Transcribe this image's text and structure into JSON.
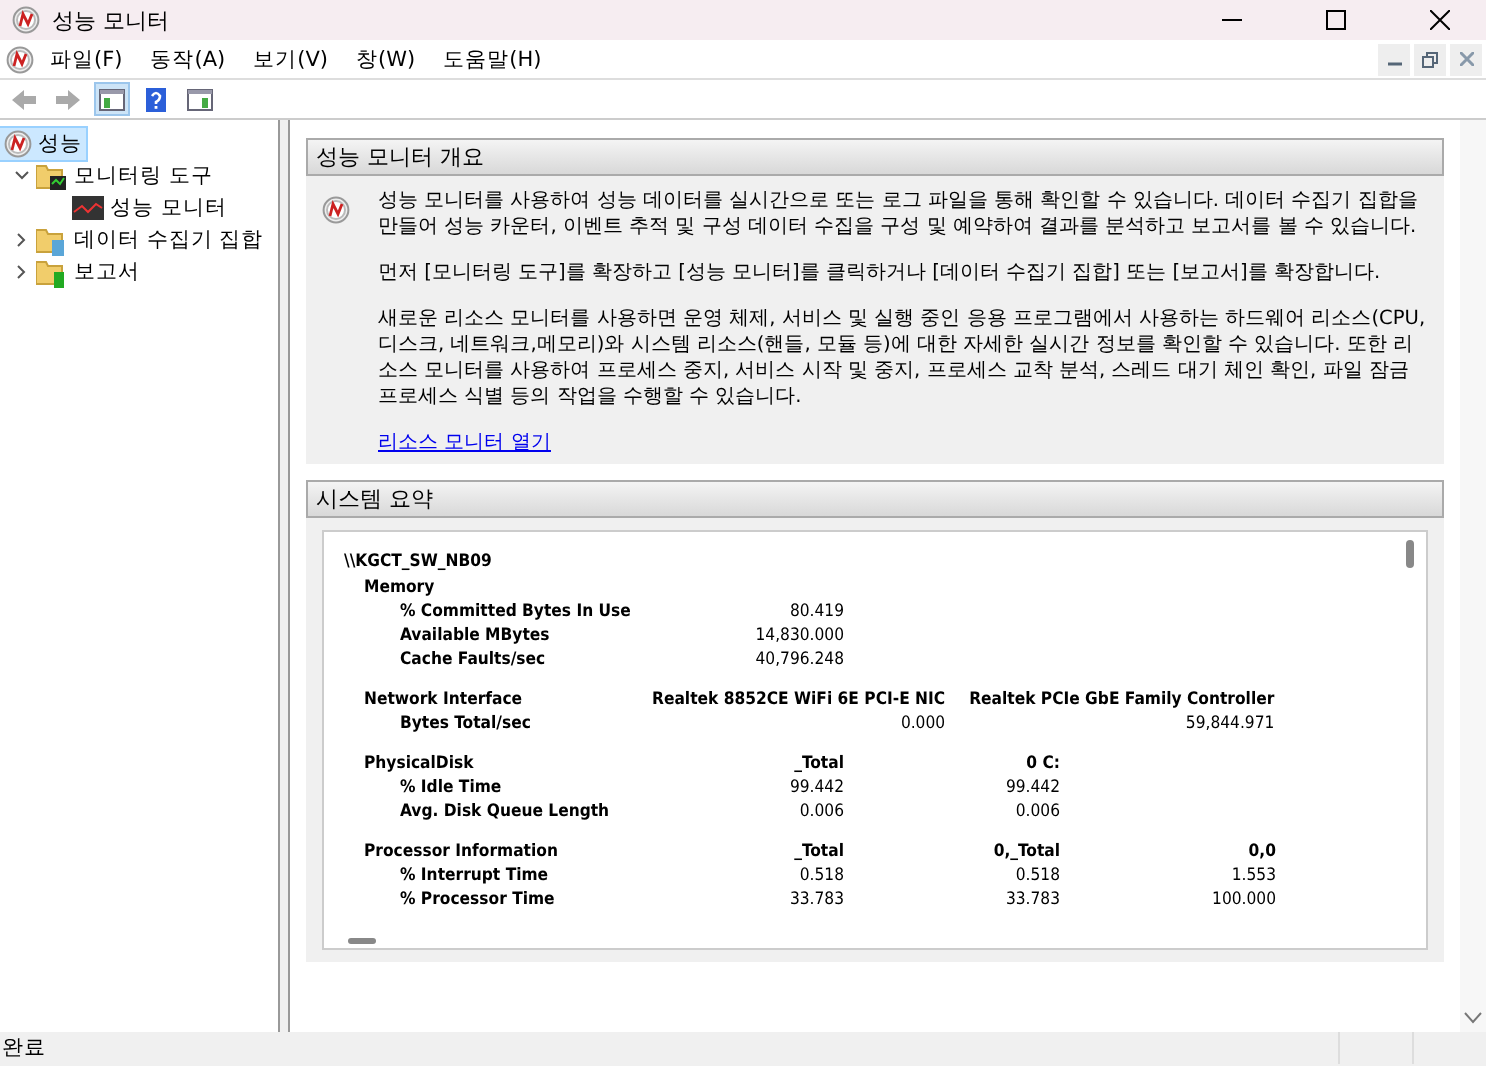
{
  "window": {
    "title": "성능 모니터"
  },
  "menu": [
    "파일(F)",
    "동작(A)",
    "보기(V)",
    "창(W)",
    "도움말(H)"
  ],
  "toolbar": [
    {
      "kind": "back",
      "disabled": true
    },
    {
      "kind": "forward",
      "disabled": true
    },
    {
      "kind": "tree",
      "selected": true
    },
    {
      "kind": "help",
      "selected": false
    },
    {
      "kind": "panel",
      "selected": false
    }
  ],
  "tree": [
    {
      "label": "성능",
      "kind": "perf",
      "selected": true,
      "children": [
        {
          "label": "모니터링 도구",
          "kind": "folder-monitor",
          "expanded": true,
          "selected": false,
          "children": [
            {
              "label": "성능 모니터",
              "kind": "chart",
              "selected": false
            }
          ]
        },
        {
          "label": "데이터 수집기 집합",
          "kind": "folder-collector",
          "expanded": false,
          "selected": false
        },
        {
          "label": "보고서",
          "kind": "folder-report",
          "expanded": false,
          "selected": false
        }
      ]
    }
  ],
  "overview": {
    "title": "성능 모니터 개요",
    "paragraphs": [
      "성능 모니터를 사용하여 성능 데이터를 실시간으로 또는 로그 파일을 통해 확인할 수 있습니다. 데이터 수집기 집합을 만들어 성능 카운터, 이벤트 추적 및 구성 데이터 수집을 구성 및 예약하여 결과를 분석하고 보고서를 볼 수 있습니다.",
      "먼저 [모니터링 도구]를 확장하고 [성능 모니터]를 클릭하거나 [데이터 수집기 집합] 또는 [보고서]를 확장합니다.",
      "새로운 리소스 모니터를 사용하면 운영 체제, 서비스 및 실행 중인 응용 프로그램에서 사용하는 하드웨어 리소스(CPU, 디스크, 네트워크,메모리)와 시스템 리소스(핸들, 모듈 등)에 대한 자세한 실시간 정보를 확인할 수 있습니다. 또한 리소스 모니터를 사용하여 프로세스 중지, 서비스 시작 및 중지, 프로세스 교착 분석, 스레드 대기 체인 확인, 파일 잠금 프로세스 식별 등의 작업을 수행할 수 있습니다."
    ],
    "link": "리소스 모니터 열기"
  },
  "summary": {
    "title": "시스템 요약",
    "host": "\\\\KGCT_SW_NB09",
    "sections": [
      {
        "name": "Memory",
        "counters": [
          {
            "name": "% Committed Bytes In Use",
            "values": [
              "80.419"
            ]
          },
          {
            "name": "Available MBytes",
            "values": [
              "14,830.000"
            ]
          },
          {
            "name": "Cache Faults/sec",
            "values": [
              "40,796.248"
            ]
          }
        ]
      },
      {
        "name": "Network Interface",
        "columns": [
          "Realtek 8852CE WiFi 6E PCI-E NIC",
          "Realtek PCIe GbE Family Controller"
        ],
        "counters": [
          {
            "name": "Bytes Total/sec",
            "values": [
              "0.000",
              "59,844.971"
            ]
          }
        ]
      },
      {
        "name": "PhysicalDisk",
        "columns": [
          "_Total",
          "0 C:"
        ],
        "counters": [
          {
            "name": "% Idle Time",
            "values": [
              "99.442",
              "99.442"
            ]
          },
          {
            "name": "Avg. Disk Queue Length",
            "values": [
              "0.006",
              "0.006"
            ]
          }
        ]
      },
      {
        "name": "Processor Information",
        "columns": [
          "_Total",
          "0,_Total",
          "0,0"
        ],
        "counters": [
          {
            "name": "% Interrupt Time",
            "values": [
              "0.518",
              "0.518",
              "1.553"
            ]
          },
          {
            "name": "% Processor Time",
            "values": [
              "33.783",
              "33.783",
              "100.000"
            ]
          }
        ]
      }
    ]
  },
  "status_bar": {
    "text": "완료"
  }
}
